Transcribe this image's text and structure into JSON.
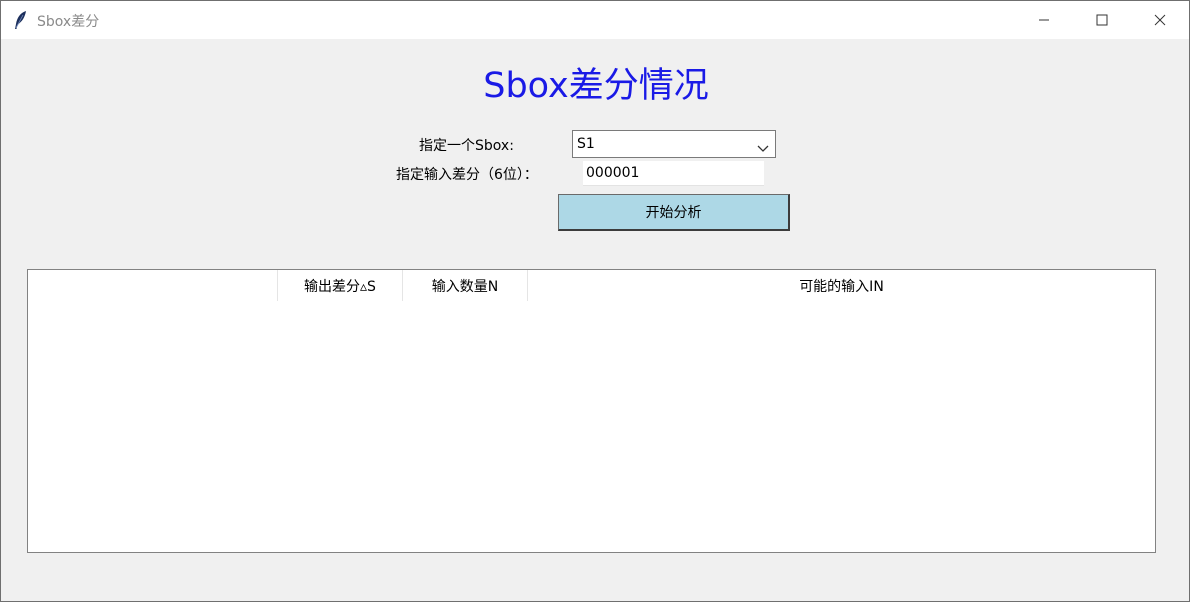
{
  "window": {
    "title": "Sbox差分",
    "icon": "feather-icon",
    "controls": [
      "minimize-icon",
      "maximize-icon",
      "close-icon"
    ]
  },
  "main": {
    "heading": "Sbox差分情况",
    "heading_color": "#1a1ae6",
    "sbox_label": "指定一个Sbox:",
    "sbox_selected": "S1",
    "diff_label": "指定输入差分（6位）：",
    "diff_value": "000001",
    "start_button": "开始分析",
    "button_color": "#add8e6"
  },
  "table": {
    "columns": [
      "",
      "输出差分▵S",
      "输入数量N",
      "可能的输入IN"
    ],
    "rows": []
  }
}
